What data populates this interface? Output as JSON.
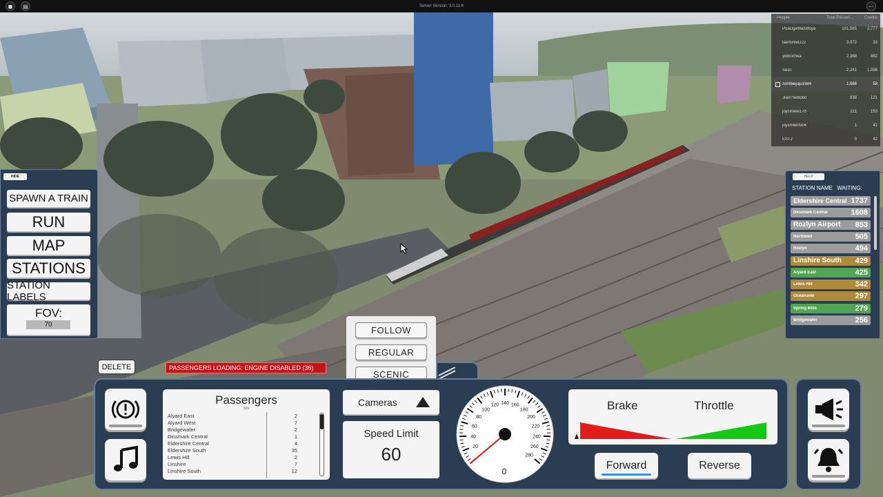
{
  "server": {
    "version": "Server Version: 3.0.11.6"
  },
  "leaderboard": {
    "headers": [
      "People",
      "Total Passen...",
      "Credits"
    ],
    "rows": [
      {
        "name": "PuaUgeWatsttoya",
        "passengers": "101,585",
        "credits": "2,777"
      },
      {
        "name": "taemintel222",
        "passengers": "3,072",
        "credits": "33"
      },
      {
        "name": "yobrochka",
        "passengers": "2,368",
        "credits": "882"
      },
      {
        "name": "Sesn",
        "passengers": "2,241",
        "credits": "1,086"
      },
      {
        "name": "zombiejuju1984",
        "passengers": "1,686",
        "credits": "58",
        "me": true
      },
      {
        "name": "JoelTheBobo",
        "passengers": "838",
        "credits": "121"
      },
      {
        "name": "joysmilee178",
        "passengers": "211",
        "credits": "153"
      },
      {
        "name": "joysmile0504",
        "passengers": "1",
        "credits": "41"
      },
      {
        "name": "ESTJ",
        "passengers": "0",
        "credits": "42"
      }
    ]
  },
  "left_menu": {
    "hide": "HIDE",
    "spawn": "SPAWN A TRAIN",
    "run": "RUN",
    "map": "MAP",
    "stations": "STATIONS",
    "labels": "STATION LABELS",
    "fov_label": "FOV:",
    "fov_value": "70"
  },
  "stations_panel": {
    "help": "HELP",
    "header_name": "STATION NAME",
    "header_waiting": "WAITING:",
    "rows": [
      {
        "name": "Eldershire Central",
        "waiting": "1737",
        "color": "#9c9c9c",
        "size": 9
      },
      {
        "name": "Dinsmark Central",
        "waiting": "1608",
        "color": "#9c9c9c",
        "size": 6
      },
      {
        "name": "Rozlyn Airport",
        "waiting": "853",
        "color": "#9c9c9c",
        "size": 10
      },
      {
        "name": "Northwell",
        "waiting": "505",
        "color": "#9c9c9c",
        "size": 6
      },
      {
        "name": "Rozlyn",
        "waiting": "494",
        "color": "#9c9c9c",
        "size": 6
      },
      {
        "name": "Linshire South",
        "waiting": "429",
        "color": "#b08a3c",
        "size": 10
      },
      {
        "name": "Alyard East",
        "waiting": "425",
        "color": "#52a552",
        "size": 6
      },
      {
        "name": "Lewis Hill",
        "waiting": "342",
        "color": "#b08a3c",
        "size": 6
      },
      {
        "name": "Oceanside",
        "waiting": "297",
        "color": "#b08a3c",
        "size": 6
      },
      {
        "name": "Spring Mills",
        "waiting": "279",
        "color": "#52a552",
        "size": 6
      },
      {
        "name": "Bridgewater",
        "waiting": "256",
        "color": "#9c9c9c",
        "size": 6
      }
    ]
  },
  "controls": {
    "delete": "DELETE",
    "warning": "PASSENGERS LOADING: ENGINE DISABLED (36)",
    "camera_options": [
      "FOLLOW",
      "REGULAR",
      "SCENIC"
    ],
    "cameras_label": "Cameras",
    "speed_limit_label": "Speed Limit",
    "speed_limit_value": "60",
    "speedometer": {
      "ticks": [
        "0",
        "20",
        "40",
        "60",
        "80",
        "100",
        "120",
        "140",
        "160",
        "180",
        "200",
        "220",
        "240",
        "260",
        "280"
      ],
      "value": 0,
      "readout": "0"
    },
    "brake_label": "Brake",
    "throttle_label": "Throttle",
    "forward": "Forward",
    "reverse": "Reverse"
  },
  "passengers_panel": {
    "title": "Passengers",
    "total": "599",
    "rows": [
      {
        "name": "Alyard East",
        "count": "2"
      },
      {
        "name": "Alyard West",
        "count": "7"
      },
      {
        "name": "Bridgewater",
        "count": "2"
      },
      {
        "name": "Dinsmark Central",
        "count": "1"
      },
      {
        "name": "Eldershire Central",
        "count": "4"
      },
      {
        "name": "Eldershire South",
        "count": "35"
      },
      {
        "name": "Lewis Hill",
        "count": "2"
      },
      {
        "name": "Linshire",
        "count": "7"
      },
      {
        "name": "Linshire South",
        "count": "12"
      }
    ]
  },
  "icons": {
    "brake_warning": "brake-warning-icon",
    "music": "music-note-icon",
    "horn": "horn-icon",
    "bell": "bell-icon"
  }
}
